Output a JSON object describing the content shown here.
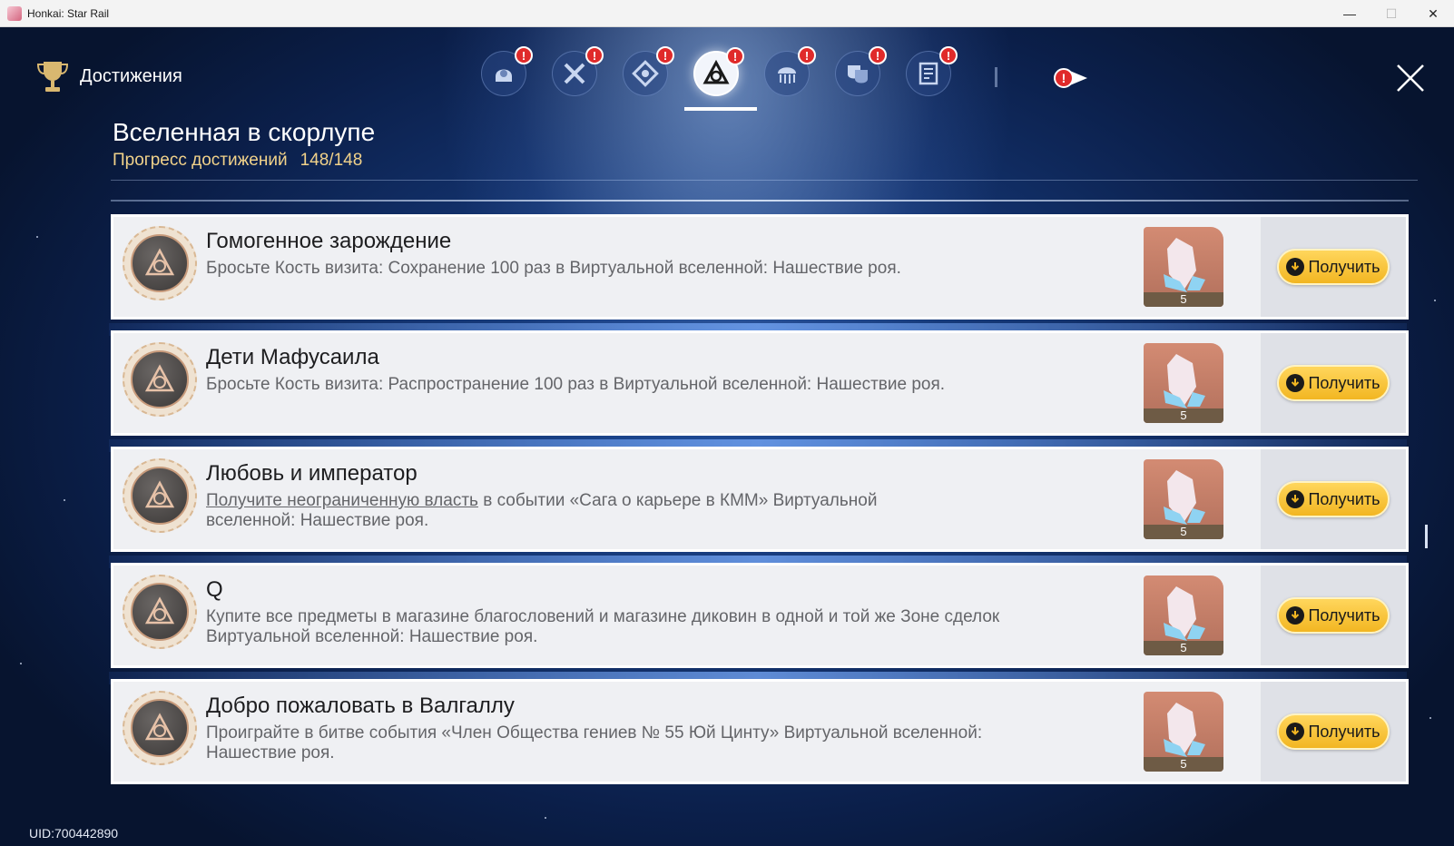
{
  "window": {
    "title": "Honkai: Star Rail",
    "minimize_label": "—",
    "maximize_label": "☐",
    "close_label": "✕"
  },
  "header": {
    "title": "Достижения",
    "tabs": [
      {
        "icon": "helmet-icon",
        "badge": "!"
      },
      {
        "icon": "crossed-swords-icon",
        "badge": "!"
      },
      {
        "icon": "star-emblem-icon",
        "badge": "!"
      },
      {
        "icon": "triad-knot-icon",
        "badge": "!",
        "active": true
      },
      {
        "icon": "jellyfish-icon",
        "badge": "!"
      },
      {
        "icon": "theater-masks-icon",
        "badge": "!"
      },
      {
        "icon": "notebook-icon",
        "badge": "!"
      }
    ],
    "more_badge": "!"
  },
  "section": {
    "title": "Вселенная в скорлупе",
    "progress_label": "Прогресс достижений",
    "progress_value": "148/148"
  },
  "achievements": [
    {
      "name": "Гомогенное зарождение",
      "desc_link": "",
      "desc": "Бросьте Кость визита: Сохранение 100 раз в Виртуальной вселенной: Нашествие роя.",
      "reward_count": "5",
      "claim_label": "Получить"
    },
    {
      "name": "Дети Мафусаила",
      "desc_link": "",
      "desc": "Бросьте Кость визита: Распространение 100 раз в Виртуальной вселенной: Нашествие роя.",
      "reward_count": "5",
      "claim_label": "Получить"
    },
    {
      "name": "Любовь и император",
      "desc_link": "Получите неограниченную власть",
      "desc": " в событии «Сага о карьере в КММ» Виртуальной вселенной: Нашествие роя.",
      "reward_count": "5",
      "claim_label": "Получить"
    },
    {
      "name": "Q",
      "desc_link": "",
      "desc": "Купите все предметы в магазине благословений и магазине диковин в одной и той же Зоне сделок Виртуальной вселенной: Нашествие роя.",
      "reward_count": "5",
      "claim_label": "Получить"
    },
    {
      "name": "Добро пожаловать в Валгаллу",
      "desc_link": "",
      "desc": "Проиграйте в битве события «Член Общества гениев № 55 Юй Цинту» Виртуальной вселенной: Нашествие роя.",
      "reward_count": "5",
      "claim_label": "Получить"
    }
  ],
  "footer": {
    "uid": "UID:700442890"
  },
  "colors": {
    "accent_gold": "#f1d28a",
    "claim_button": "#f2b622",
    "badge_red": "#e02a2a"
  }
}
